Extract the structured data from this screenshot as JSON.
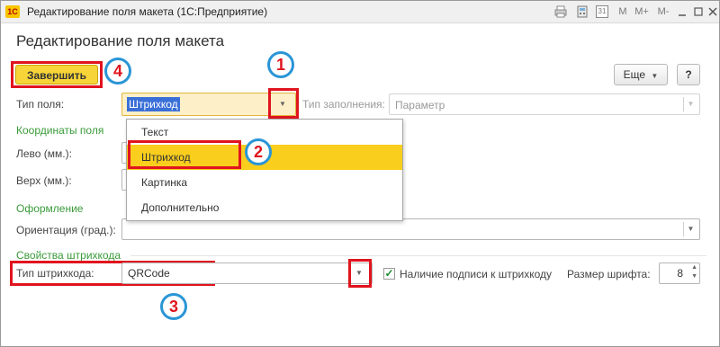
{
  "window": {
    "title": "Редактирование поля макета  (1С:Предприятие)",
    "logo_text": "1С",
    "toolbar_icons": [
      "printer-icon",
      "calculator-icon",
      "calendar-icon"
    ],
    "calendar_day": "31",
    "memory_buttons": [
      "M",
      "M+",
      "M-"
    ]
  },
  "heading": "Редактирование поля макета",
  "toolbar": {
    "finish_label": "Завершить",
    "more_label": "Еще",
    "help_label": "?"
  },
  "field_type": {
    "label": "Тип поля:",
    "value": "Штрихкод"
  },
  "fill_type": {
    "label": "Тип заполнения:",
    "value": "Параметр"
  },
  "dropdown": {
    "options": [
      "Текст",
      "Штрихкод",
      "Картинка",
      "Дополнительно"
    ],
    "selected": "Штрихкод"
  },
  "coords": {
    "section": "Координаты поля",
    "left_label": "Лево (мм.):",
    "top_label": "Верх (мм.):"
  },
  "design": {
    "section": "Оформление",
    "orientation_label": "Ориентация (град.):"
  },
  "barcode": {
    "section": "Свойства штрихкода",
    "type_label": "Тип штрихкода:",
    "type_value": "QRCode",
    "caption_checkbox_label": "Наличие подписи к штрихкоду",
    "caption_checked": true,
    "font_size_label": "Размер шрифта:",
    "font_size_value": "8"
  },
  "callouts": [
    "1",
    "2",
    "3",
    "4"
  ],
  "colors": {
    "accent": "#f9ce1d",
    "highlight_red": "#e0141e",
    "callout_blue": "#2a95d6",
    "section_green": "#3a9b3a"
  }
}
